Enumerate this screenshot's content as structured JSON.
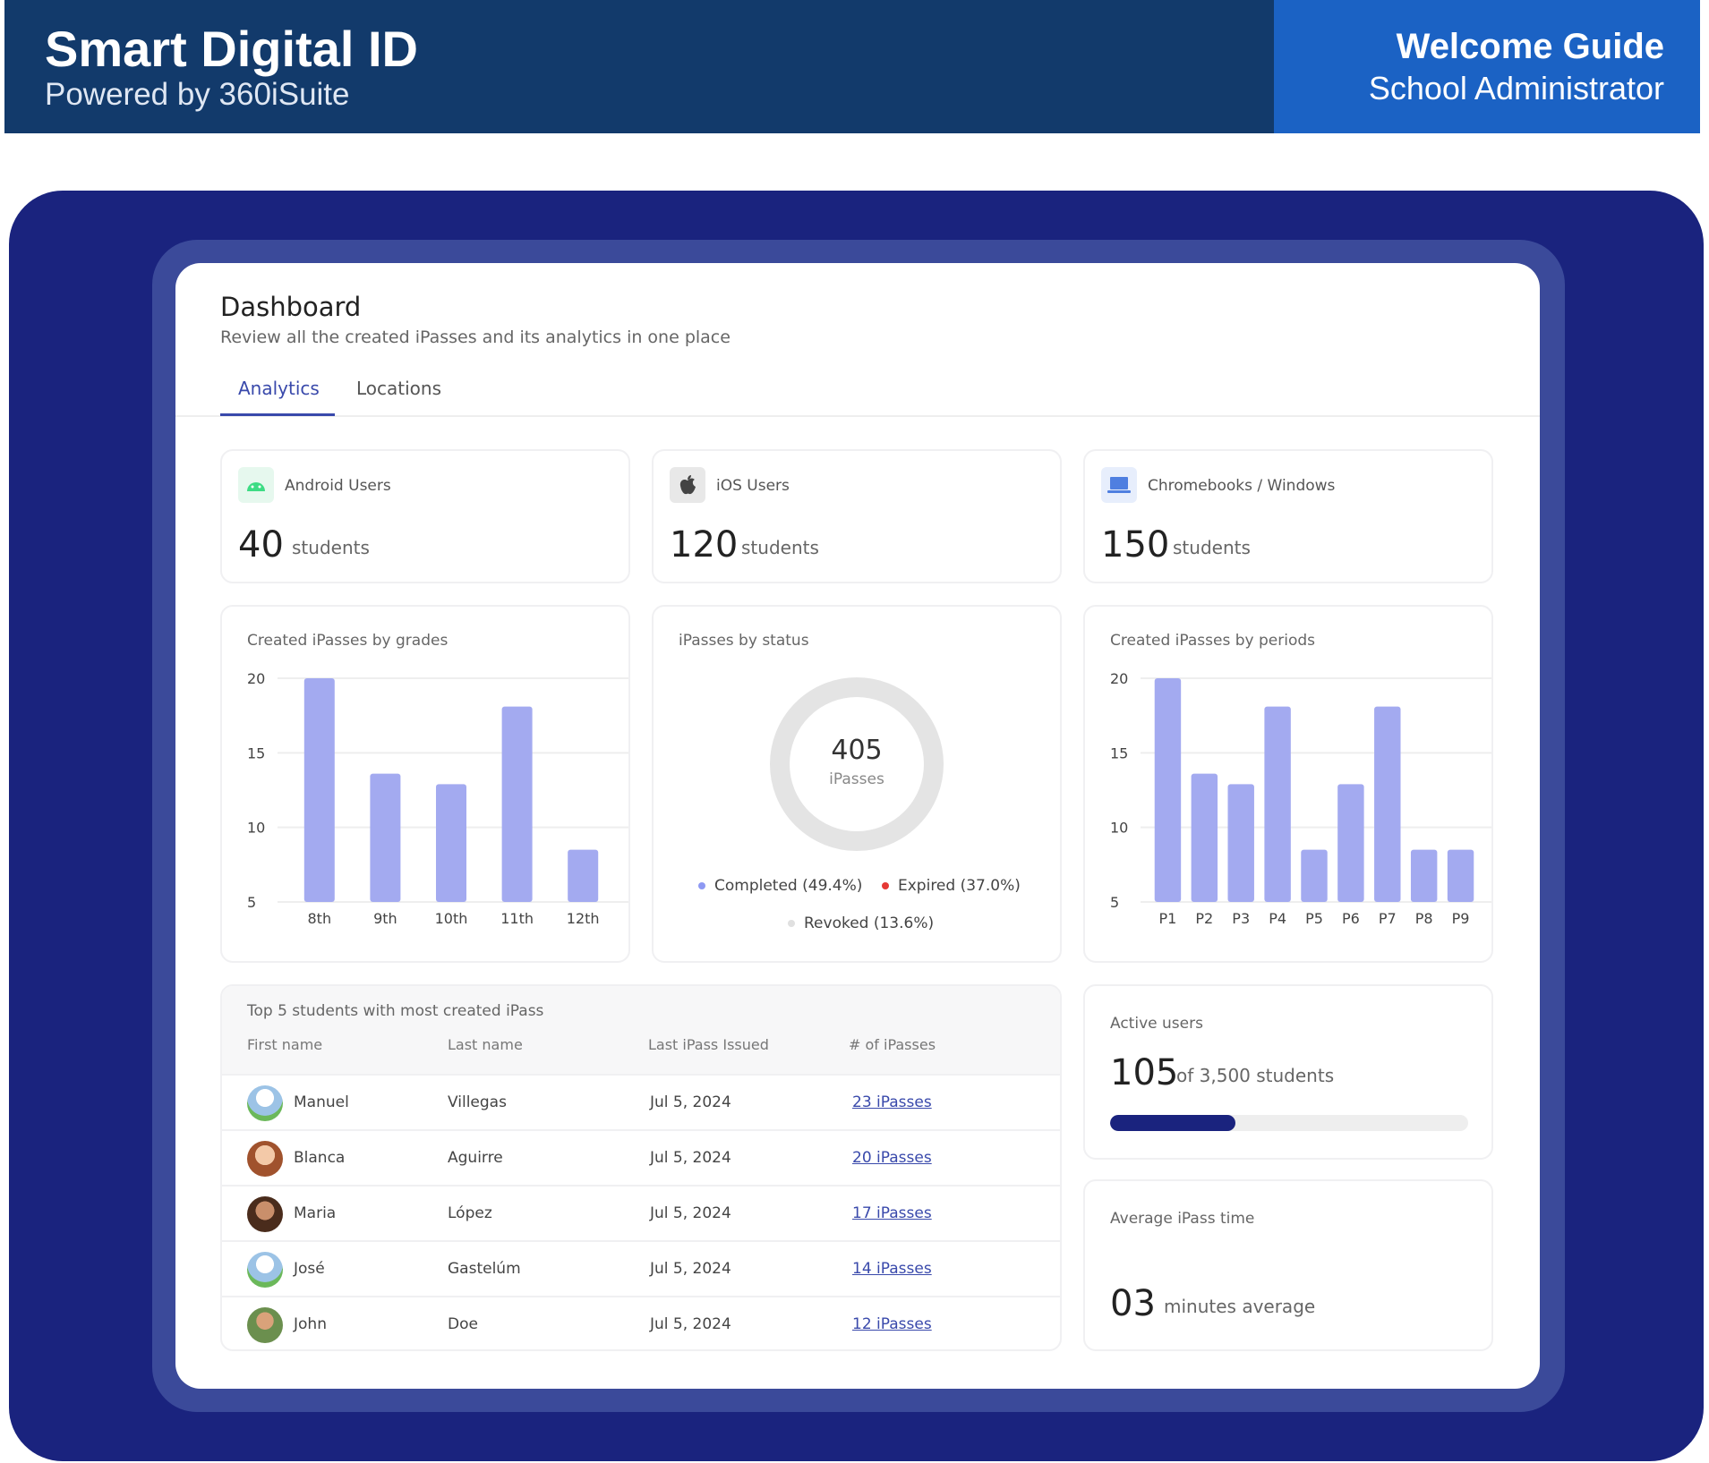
{
  "header": {
    "brand_title": "Smart Digital ID",
    "brand_subtitle": "Powered by 360iSuite",
    "guide_title": "Welcome Guide",
    "guide_subtitle": "School Administrator",
    "colors": {
      "left": "#123a6b",
      "right": "#1b62c4",
      "frame": "#1a237e"
    }
  },
  "dashboard": {
    "title": "Dashboard",
    "subtitle": "Review all the created iPasses and its analytics in one place",
    "tabs": [
      {
        "label": "Analytics",
        "active": true
      },
      {
        "label": "Locations",
        "active": false
      }
    ]
  },
  "stats": [
    {
      "label": "Android Users",
      "value": "40",
      "unit": "students",
      "icon": "android-icon",
      "color": "#3ddc84"
    },
    {
      "label": "iOS Users",
      "value": "120",
      "unit": "students",
      "icon": "apple-icon",
      "color": "#555555"
    },
    {
      "label": "Chromebooks / Windows",
      "value": "150",
      "unit": "students",
      "icon": "laptop-icon",
      "color": "#4f7fe0"
    }
  ],
  "charts": {
    "grades": {
      "label": "Created iPasses by grades",
      "y_ticks": [
        "20",
        "15",
        "10",
        "5"
      ]
    },
    "status": {
      "label": "iPasses by status",
      "total": "405",
      "unit": "iPasses",
      "legend": [
        "Completed (49.4%)",
        "Expired (37.0%)",
        "Revoked (13.6%)"
      ],
      "colors": [
        "#8e99f3",
        "#e53935",
        "#e0e0e0"
      ]
    },
    "periods": {
      "label": "Created iPasses by periods",
      "y_ticks": [
        "20",
        "15",
        "10",
        "5"
      ]
    }
  },
  "chart_data": [
    {
      "type": "bar",
      "title": "Created iPasses by grades",
      "categories": [
        "8th",
        "9th",
        "10th",
        "11th",
        "12th"
      ],
      "values": [
        20,
        13.6,
        12.9,
        18.1,
        8.5
      ],
      "ylim": [
        5,
        20
      ],
      "yticks": [
        20,
        15,
        10,
        5
      ],
      "color": "#a3aaf0"
    },
    {
      "type": "pie",
      "title": "iPasses by status",
      "categories": [
        "Completed",
        "Expired",
        "Revoked"
      ],
      "values": [
        49.4,
        37.0,
        13.6
      ]
    },
    {
      "type": "bar",
      "title": "Created iPasses by periods",
      "categories": [
        "P1",
        "P2",
        "P3",
        "P4",
        "P5",
        "P6",
        "P7",
        "P8",
        "P9"
      ],
      "values": [
        20,
        13.6,
        12.9,
        18.1,
        8.5,
        12.9,
        18.1,
        8.5,
        8.5
      ],
      "ylim": [
        5,
        20
      ],
      "yticks": [
        20,
        15,
        10,
        5
      ],
      "color": "#a3aaf0"
    }
  ],
  "table": {
    "title": "Top 5 students with most created iPass",
    "columns": [
      "First name",
      "Last name",
      "Last iPass Issued",
      "# of iPasses"
    ],
    "rows": [
      {
        "first": "Manuel",
        "last": "Villegas",
        "date": "Jul 5, 2024",
        "count": "23 iPasses"
      },
      {
        "first": "Blanca",
        "last": "Aguirre",
        "date": "Jul 5, 2024",
        "count": "20 iPasses"
      },
      {
        "first": "Maria",
        "last": "López",
        "date": "Jul 5, 2024",
        "count": "17 iPasses"
      },
      {
        "first": "José",
        "last": "Gastelúm",
        "date": "Jul 5, 2024",
        "count": "14 iPasses"
      },
      {
        "first": "John",
        "last": "Doe",
        "date": "Jul 5, 2024",
        "count": "12 iPasses"
      }
    ]
  },
  "active_users": {
    "label": "Active users",
    "value": "105",
    "unit": "of 3,500 students",
    "progress": 0.35
  },
  "avg_time": {
    "label": "Average iPass time",
    "value": "03",
    "unit": "minutes average"
  }
}
